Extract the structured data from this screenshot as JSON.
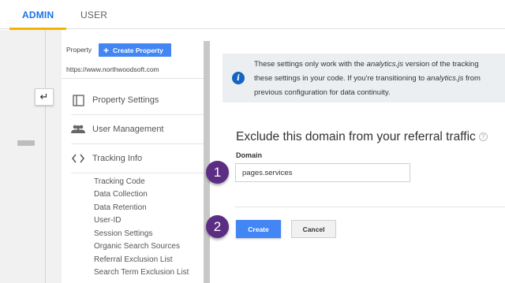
{
  "tabs": {
    "admin": "ADMIN",
    "user": "USER"
  },
  "colors": {
    "accent_blue": "#4285f4",
    "tab_active": "#1a73e8",
    "tab_underline": "#f4b400",
    "step_badge": "#5b2d83",
    "info_icon": "#1565c0"
  },
  "property": {
    "label": "Property",
    "create_button": "Create Property",
    "url": "https://www.northwoodsoft.com"
  },
  "menu": {
    "items": [
      {
        "label": "Property Settings",
        "icon": "property-settings-icon"
      },
      {
        "label": "User Management",
        "icon": "users-icon"
      },
      {
        "label": "Tracking Info",
        "icon": "code-icon"
      }
    ],
    "tracking_sub_items": [
      "Tracking Code",
      "Data Collection",
      "Data Retention",
      "User-ID",
      "Session Settings",
      "Organic Search Sources",
      "Referral Exclusion List",
      "Search Term Exclusion List"
    ]
  },
  "info": {
    "line1_pre": "These settings only work with the ",
    "line1_em": "analytics.js",
    "line1_post": " version of the tracking",
    "line2_pre": "these settings in your code. If you're transitioning to ",
    "line2_em": "analytics.js",
    "line2_post": " from",
    "line3": "previous configuration for data continuity."
  },
  "form": {
    "title": "Exclude this domain from your referral traffic",
    "help": "?",
    "domain_label": "Domain",
    "domain_value": "pages.services",
    "create_label": "Create",
    "cancel_label": "Cancel"
  },
  "steps": {
    "one": "1",
    "two": "2"
  }
}
